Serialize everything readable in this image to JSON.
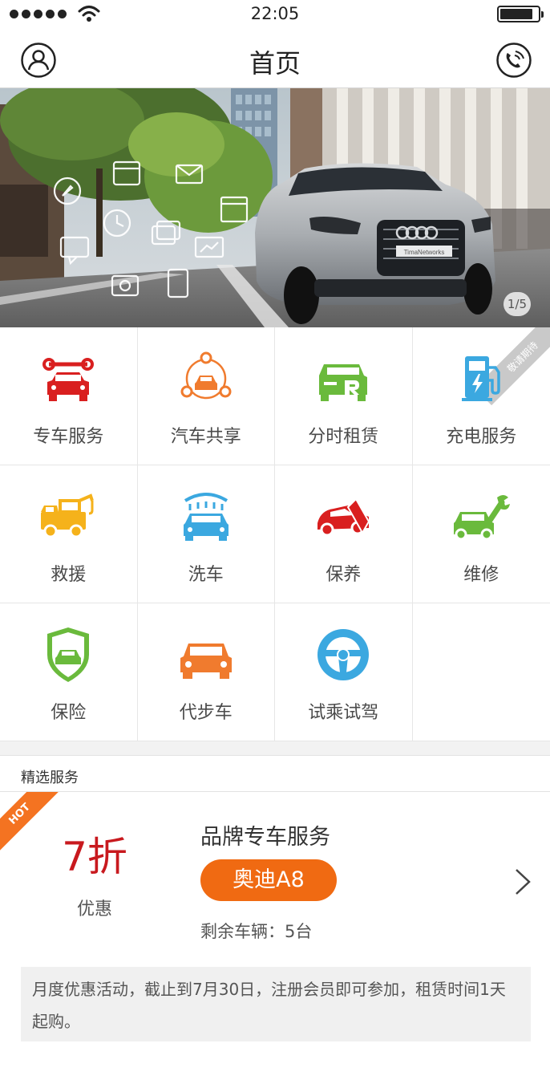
{
  "status_bar": {
    "time": "22:05"
  },
  "header": {
    "title": "首页"
  },
  "banner": {
    "page_indicator": "1/5",
    "plate": "TimaNetworks"
  },
  "services": [
    {
      "label": "专车服务",
      "icon": "car-wrench-icon",
      "color": "#d91f1f"
    },
    {
      "label": "汽车共享",
      "icon": "car-share-icon",
      "color": "#f07b2e"
    },
    {
      "label": "分时租赁",
      "icon": "car-rent-icon",
      "color": "#6aba3c"
    },
    {
      "label": "充电服务",
      "icon": "charging-station-icon",
      "color": "#3ba8e0",
      "ribbon": "敬请期待"
    },
    {
      "label": "救援",
      "icon": "tow-truck-icon",
      "color": "#f5b21b"
    },
    {
      "label": "洗车",
      "icon": "car-wash-icon",
      "color": "#3ba8e0"
    },
    {
      "label": "保养",
      "icon": "car-maintain-icon",
      "color": "#d91f1f"
    },
    {
      "label": "维修",
      "icon": "car-repair-icon",
      "color": "#6aba3c"
    },
    {
      "label": "保险",
      "icon": "insurance-shield-icon",
      "color": "#6aba3c"
    },
    {
      "label": "代步车",
      "icon": "substitute-car-icon",
      "color": "#f07b2e"
    },
    {
      "label": "试乘试驾",
      "icon": "steering-wheel-icon",
      "color": "#3ba8e0"
    }
  ],
  "featured": {
    "section_title": "精选服务",
    "hot_label": "HOT",
    "discount": "7折",
    "discount_sub": "优惠",
    "title": "品牌专车服务",
    "car_model": "奥迪A8",
    "remaining": "剩余车辆：5台",
    "promo": "月度优惠活动，截止到7月30日，注册会员即可参加，租赁时间1天起购。"
  }
}
